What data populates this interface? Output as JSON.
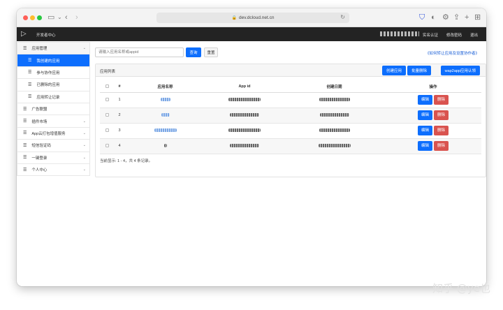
{
  "browser": {
    "url": "dev.dcloud.net.cn"
  },
  "appbar": {
    "title": "开发者中心",
    "links": [
      "实名认证",
      "修改密码",
      "退出"
    ]
  },
  "sidebar": {
    "group": {
      "label": "应用管理",
      "items": [
        "我创建的应用",
        "参与协作应用",
        "已删除的应用",
        "应用转让记录"
      ]
    },
    "others": [
      "广告联盟",
      "插件市场",
      "App云打包增值服务",
      "短信验证码",
      "一键登录",
      "个人中心"
    ]
  },
  "search": {
    "placeholder": "请输入应用名称或appid",
    "search_label": "查询",
    "reset_label": "重置",
    "help_link": "《如何转让应用及设置协作者》"
  },
  "panel": {
    "title": "应用列表",
    "buttons": {
      "create": "创建应用",
      "batch_delete": "批量删除",
      "wap2app": "wap2app应用认领"
    },
    "columns": {
      "index": "#",
      "name": "应用名称",
      "appid": "App id",
      "created": "创建日期",
      "ops": "操作"
    },
    "rows": [
      {
        "index": "1"
      },
      {
        "index": "2"
      },
      {
        "index": "3"
      },
      {
        "index": "4"
      }
    ],
    "edit_label": "编辑",
    "delete_label": "删除",
    "summary": "当前显示: 1 - 4，共 4 条记录。"
  },
  "watermark": "知乎 @ye也"
}
